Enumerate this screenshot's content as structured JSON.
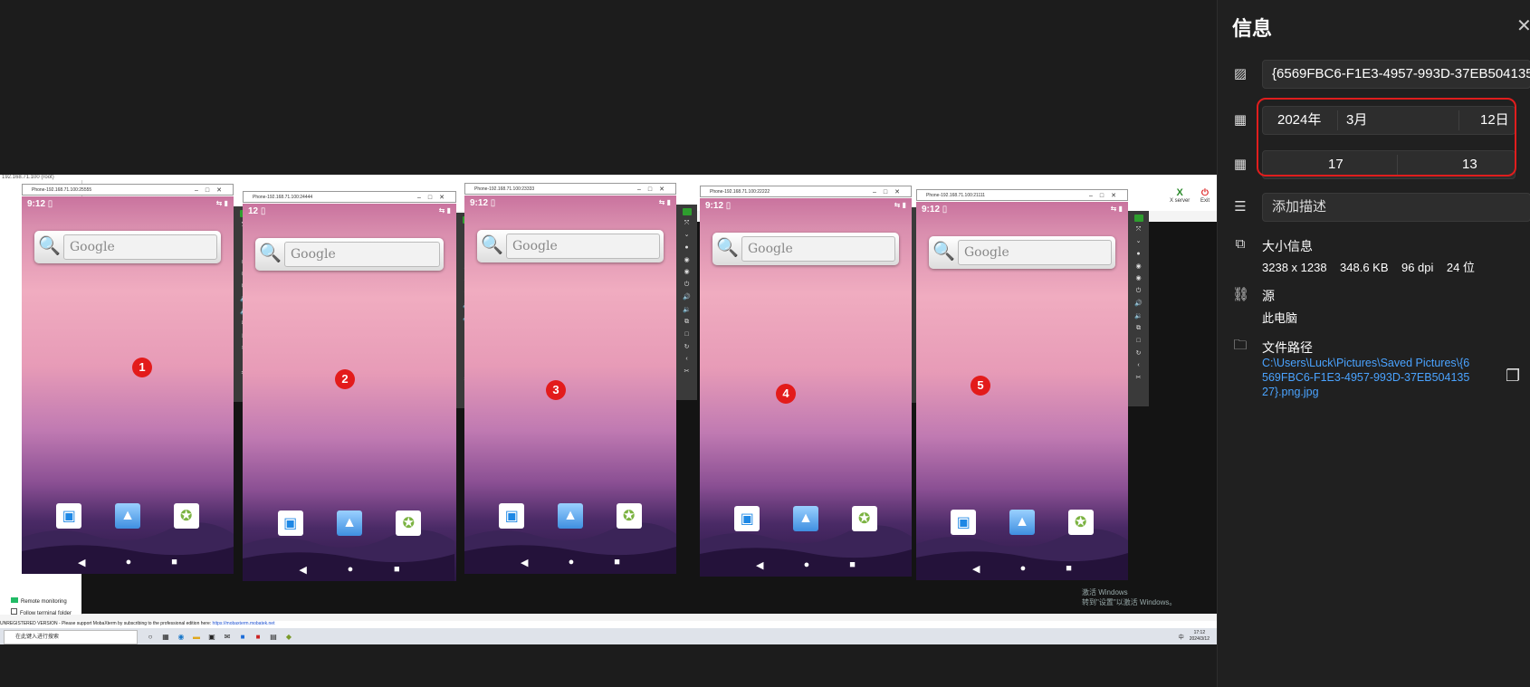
{
  "info_panel": {
    "title": "信息",
    "file_name": "{6569FBC6-F1E3-4957-993D-37EB50413527}",
    "date": {
      "year": "2024年",
      "month": "3月",
      "day": "12日"
    },
    "time": {
      "hour": "17",
      "minute": "13"
    },
    "description_placeholder": "添加描述",
    "size_section": {
      "label": "大小信息",
      "dimensions": "3238 x 1238",
      "file_size": "348.6 KB",
      "dpi": "96 dpi",
      "bit_depth": "24 位"
    },
    "source_section": {
      "label": "源",
      "value": "此电脑"
    },
    "path_section": {
      "label": "文件路径",
      "value": "C:\\Users\\Luck\\Pictures\\Saved Pictures\\{6569FBC6-F1E3-4957-993D-37EB50413527}.png.jpg"
    },
    "icons": {
      "image": "image-icon",
      "calendar": "calendar-icon",
      "clock": "calendar-clock-icon",
      "description": "lines-icon",
      "size": "size-icon",
      "source": "link-icon",
      "folder": "folder-icon",
      "copy": "copy-icon",
      "close": "close-icon"
    }
  },
  "screenshot": {
    "mobaxterm_title": "192.168.71.100 (root)",
    "status_bar": {
      "text": "UNREGISTERED VERSION  -  Please support MobaXterm by subscribing to the professional edition here: ",
      "link": "https://mobaxterm.mobatek.net"
    },
    "remote_monitoring": "Remote monitoring",
    "follow_terminal": "Follow terminal folder",
    "toolbar_right": {
      "x_server": "X server",
      "exit": "Exit"
    },
    "watermark": {
      "line1": "激活 Windows",
      "line2": "转到\"设置\"以激活 Windows。"
    },
    "taskbar": {
      "search_placeholder": "在此键入进行搜索",
      "time": "17:12",
      "date": "2024/3/12",
      "lang": "中"
    },
    "phones": [
      {
        "title": "Phone-192.168.71.100:25555",
        "time": "9:12",
        "label": "1",
        "search": "Google"
      },
      {
        "title": "Phone-192.168.71.100:24444",
        "time": "12",
        "label": "2",
        "search": "Google"
      },
      {
        "title": "Phone-192.168.71.100:23333",
        "time": "9:12",
        "label": "3",
        "search": "Google"
      },
      {
        "title": "Phone-192.168.71.100:22222",
        "time": "9:12",
        "label": "4",
        "search": "Google"
      },
      {
        "title": "Phone-192.168.71.100:21111",
        "time": "9:12",
        "label": "5",
        "search": "Google"
      }
    ]
  }
}
